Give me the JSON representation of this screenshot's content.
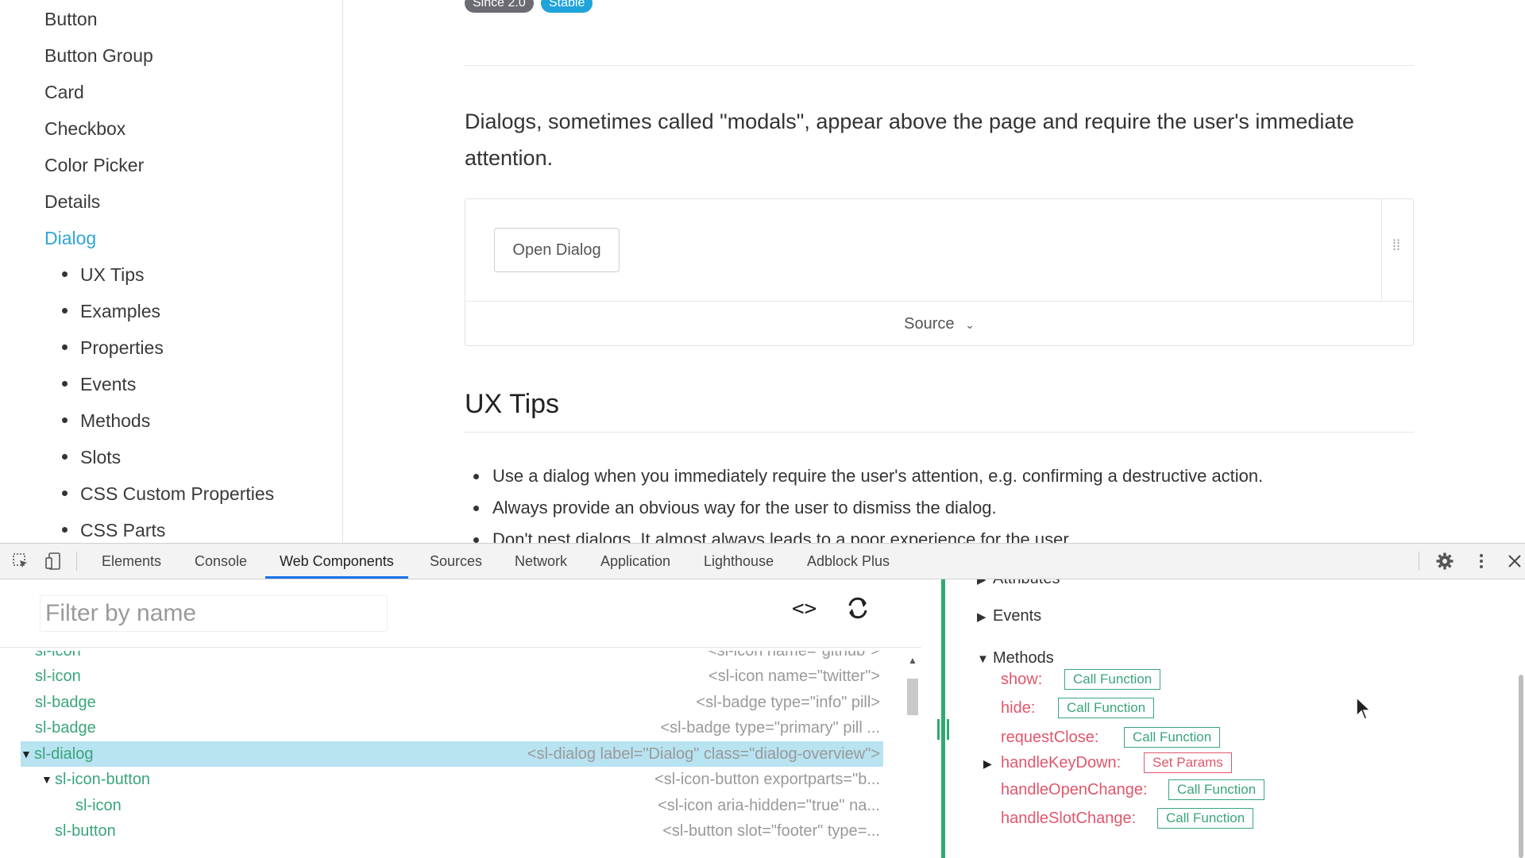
{
  "sidebar": {
    "items": [
      {
        "label": "Button",
        "active": false
      },
      {
        "label": "Button Group",
        "active": false
      },
      {
        "label": "Card",
        "active": false
      },
      {
        "label": "Checkbox",
        "active": false
      },
      {
        "label": "Color Picker",
        "active": false
      },
      {
        "label": "Details",
        "active": false
      },
      {
        "label": "Dialog",
        "active": true
      }
    ],
    "subitems": [
      "UX Tips",
      "Examples",
      "Properties",
      "Events",
      "Methods",
      "Slots",
      "CSS Custom Properties",
      "CSS Parts"
    ]
  },
  "content": {
    "badges": {
      "since": "Since 2.0",
      "stable": "Stable"
    },
    "intro": "Dialogs, sometimes called \"modals\", appear above the page and require the user's immediate attention.",
    "demo": {
      "open_button": "Open Dialog",
      "source_label": "Source"
    },
    "ux_heading": "UX Tips",
    "tips": [
      "Use a dialog when you immediately require the user's attention, e.g. confirming a destructive action.",
      "Always provide an obvious way for the user to dismiss the dialog.",
      "Don't nest dialogs. It almost always leads to a poor experience for the user."
    ]
  },
  "devtools": {
    "tabs": [
      "Elements",
      "Console",
      "Web Components",
      "Sources",
      "Network",
      "Application",
      "Lighthouse",
      "Adblock Plus"
    ],
    "active_tab": "Web Components",
    "filter_placeholder": "Filter by name",
    "code_toggle": "<>",
    "tree": [
      {
        "name": "sl-icon",
        "desc": "<sl-icon name=\"github\">",
        "selected": false,
        "expanded": null
      },
      {
        "name": "sl-icon",
        "desc": "<sl-icon name=\"twitter\">",
        "selected": false,
        "expanded": null
      },
      {
        "name": "sl-badge",
        "desc": "<sl-badge type=\"info\" pill>",
        "selected": false,
        "expanded": null
      },
      {
        "name": "sl-badge",
        "desc": "<sl-badge type=\"primary\" pill ...",
        "selected": false,
        "expanded": null
      },
      {
        "name": "sl-dialog",
        "desc": "<sl-dialog label=\"Dialog\" class=\"dialog-overview\">",
        "selected": true,
        "expanded": true
      },
      {
        "name": "sl-icon-button",
        "desc": "<sl-icon-button exportparts=\"b...",
        "selected": false,
        "expanded": true
      },
      {
        "name": "sl-icon",
        "desc": "<sl-icon aria-hidden=\"true\" na...",
        "selected": false,
        "expanded": null
      },
      {
        "name": "sl-button",
        "desc": "<sl-button slot=\"footer\" type=...",
        "selected": false,
        "expanded": null
      }
    ],
    "right": {
      "partial_section": "Attributes",
      "events_label": "Events",
      "methods_label": "Methods",
      "methods": [
        {
          "name": "show:",
          "button": "Call Function",
          "type": "call",
          "expandable": false
        },
        {
          "name": "hide:",
          "button": "Call Function",
          "type": "call",
          "expandable": false
        },
        {
          "name": "requestClose:",
          "button": "Call Function",
          "type": "call",
          "expandable": false
        },
        {
          "name": "handleKeyDown:",
          "button": "Set Params",
          "type": "params",
          "expandable": true
        },
        {
          "name": "handleOpenChange:",
          "button": "Call Function",
          "type": "call",
          "expandable": false
        },
        {
          "name": "handleSlotChange:",
          "button": "Call Function",
          "type": "call",
          "expandable": false
        }
      ]
    },
    "colors": {
      "accent": "#1a73e8",
      "component": "#3aa57a",
      "method": "#e1566c",
      "selected": "#b8e3f1"
    }
  }
}
